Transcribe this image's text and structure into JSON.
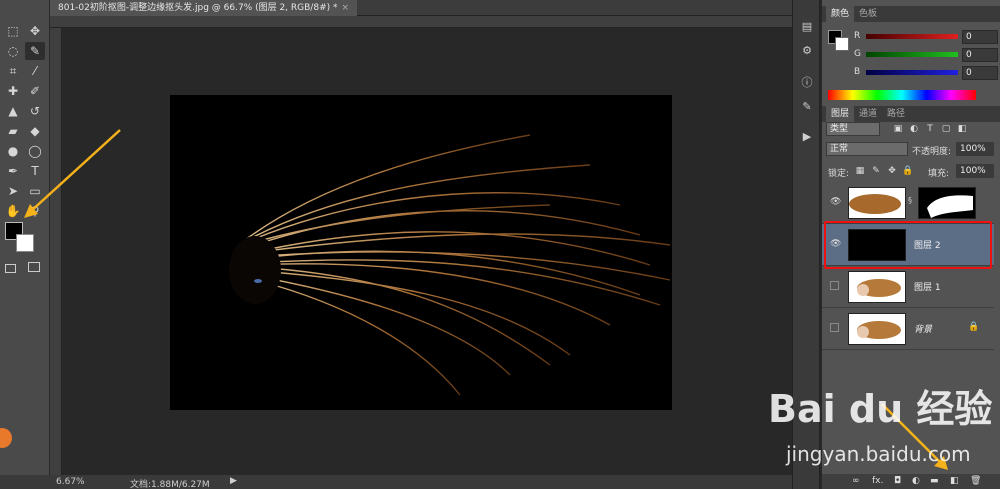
{
  "document": {
    "tab_title": "801-02初阶抠图-调整边缘抠头发.jpg @ 66.7% (图层 2, RGB/8#) *",
    "zoom": "6.67%",
    "doc_size": "文档:1.88M/6.27M"
  },
  "color_panel": {
    "tabs": [
      "颜色",
      "色板"
    ],
    "channels": [
      {
        "label": "R",
        "value": "0",
        "color": "#e02020"
      },
      {
        "label": "G",
        "value": "0",
        "color": "#20c020"
      },
      {
        "label": "B",
        "value": "0",
        "color": "#2020e0"
      }
    ]
  },
  "layers_panel": {
    "tabs": [
      "图层",
      "通道",
      "路径"
    ],
    "filter_kind": "类型",
    "blend_mode": "正常",
    "opacity_label": "不透明度:",
    "opacity_value": "100%",
    "lock_label": "锁定:",
    "fill_label": "填充:",
    "fill_value": "100%",
    "layers": [
      {
        "name": "",
        "visible": true,
        "selected": false,
        "has_mask": true
      },
      {
        "name": "图层 2",
        "visible": true,
        "selected": true,
        "has_mask": false
      },
      {
        "name": "图层 1",
        "visible": false,
        "selected": false,
        "has_mask": false
      },
      {
        "name": "背景",
        "visible": false,
        "selected": false,
        "has_mask": false,
        "locked": true
      }
    ]
  },
  "watermark": {
    "logo": "Bai du 经验",
    "url": "jingyan.baidu.com"
  },
  "colors": {
    "selected_layer": "#5c6e86",
    "highlight": "#e11111",
    "arrow": "#f5b21b"
  }
}
